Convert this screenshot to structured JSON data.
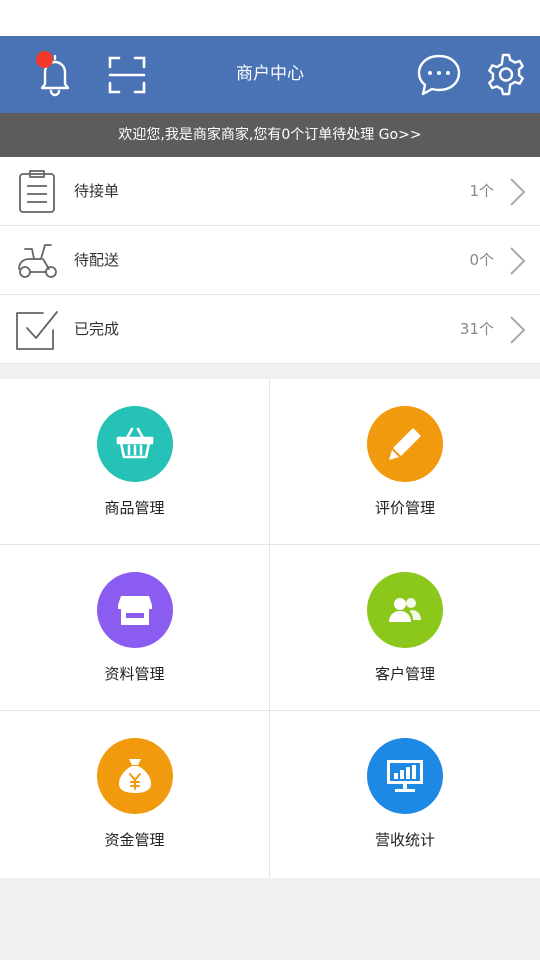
{
  "header": {
    "title": "商户中心",
    "bell_icon": "bell-icon",
    "scan_icon": "scan-icon",
    "message_icon": "chat-bubble-icon",
    "settings_icon": "gear-icon",
    "accent_color": "#4a73b5",
    "badge_color": "#f23a2c"
  },
  "notice": {
    "text": "欢迎您,我是商家商家,您有0个订单待处理 Go>>"
  },
  "orders": [
    {
      "label": "待接单",
      "count": "1个",
      "icon": "clipboard-icon"
    },
    {
      "label": "待配送",
      "count": "0个",
      "icon": "scooter-icon"
    },
    {
      "label": "已完成",
      "count": "31个",
      "icon": "checkbox-icon"
    }
  ],
  "modules": [
    {
      "label": "商品管理",
      "icon": "basket-icon",
      "color": "#26c2b8"
    },
    {
      "label": "评价管理",
      "icon": "pencil-icon",
      "color": "#f29a0e"
    },
    {
      "label": "资料管理",
      "icon": "storefront-icon",
      "color": "#8b5cf0"
    },
    {
      "label": "客户管理",
      "icon": "users-icon",
      "color": "#8cc71c"
    },
    {
      "label": "资金管理",
      "icon": "money-bag-icon",
      "color": "#f29a0e"
    },
    {
      "label": "营收统计",
      "icon": "chart-monitor-icon",
      "color": "#1e88e5"
    }
  ]
}
